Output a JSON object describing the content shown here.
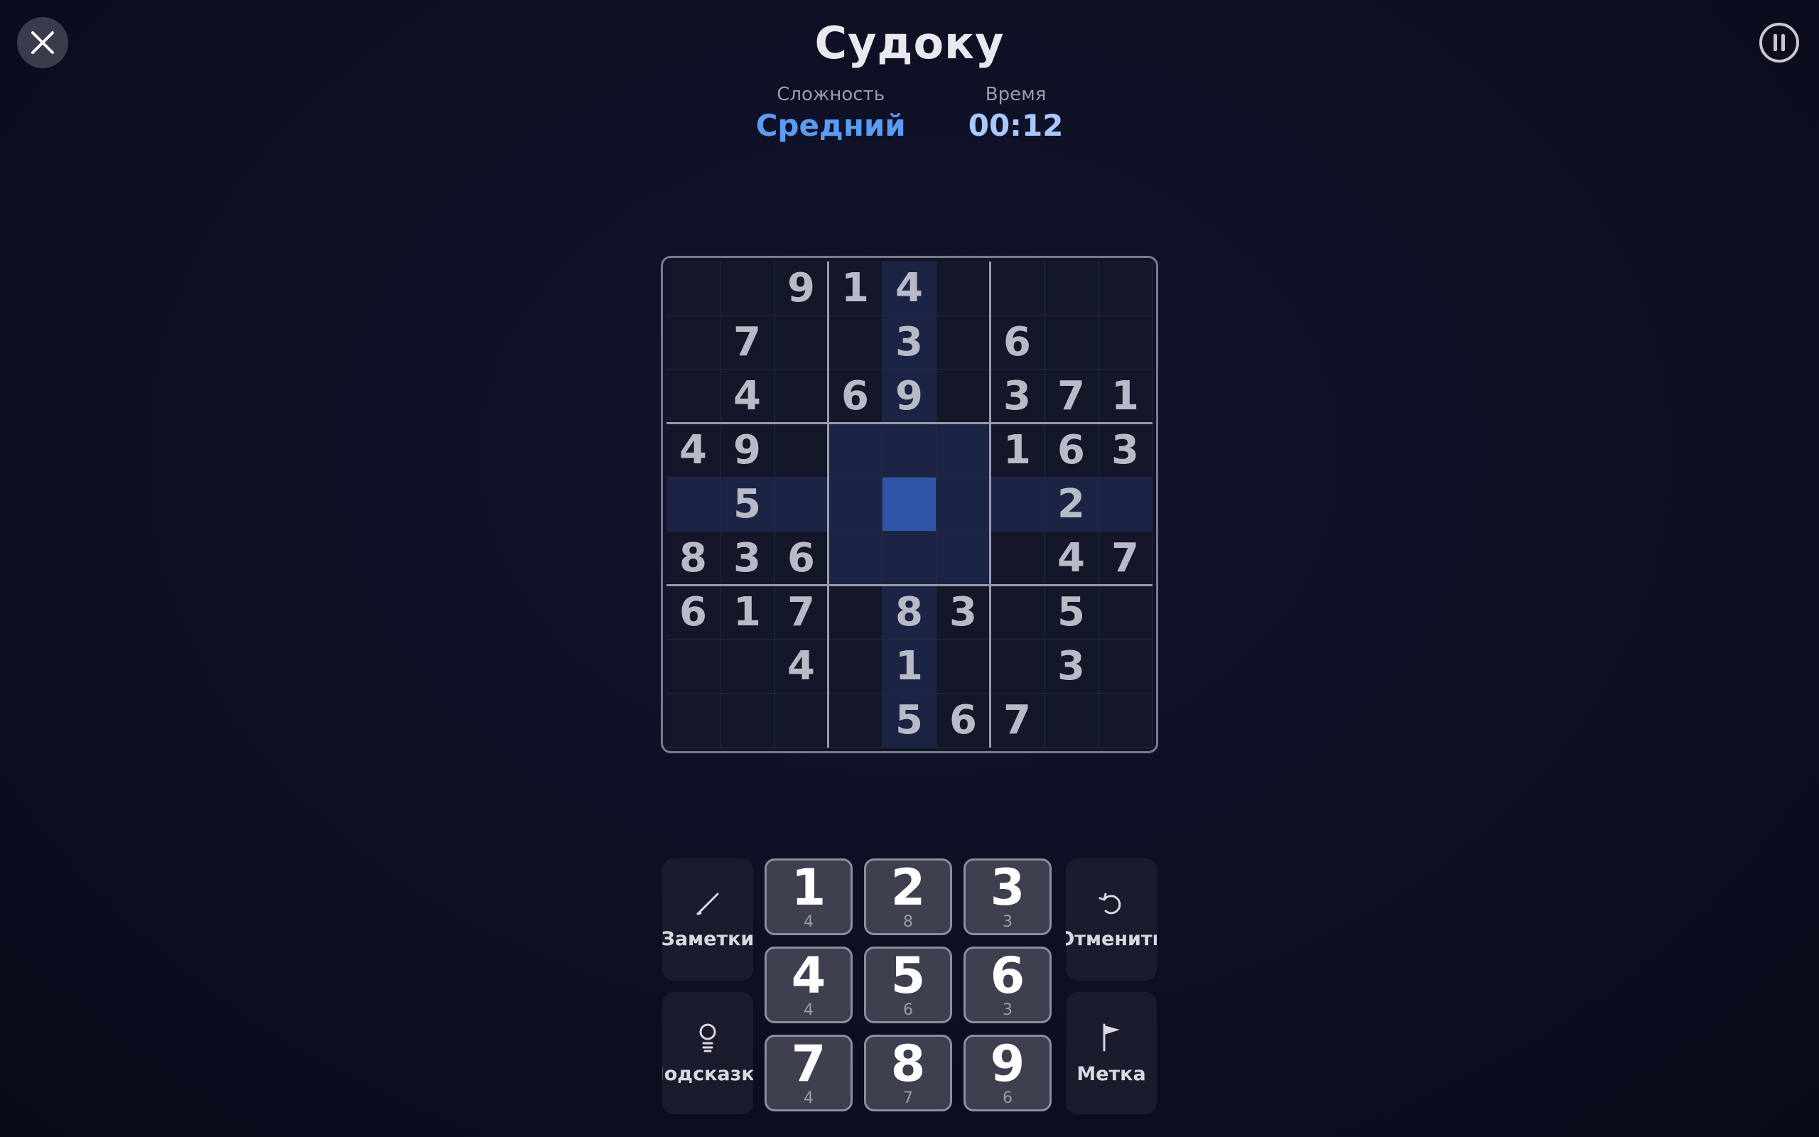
{
  "header": {
    "title": "Судоку"
  },
  "stats": {
    "difficulty_label": "Сложность",
    "difficulty_value": "Средний",
    "time_label": "Время",
    "time_value": "00:12"
  },
  "board": {
    "rows": [
      [
        "",
        "",
        "9",
        "1",
        "4",
        "",
        "",
        "",
        ""
      ],
      [
        "",
        "7",
        "",
        "",
        "3",
        "",
        "6",
        "",
        ""
      ],
      [
        "",
        "4",
        "",
        "6",
        "9",
        "",
        "3",
        "7",
        "1"
      ],
      [
        "4",
        "9",
        "",
        "",
        "",
        "",
        "1",
        "6",
        "3"
      ],
      [
        "",
        "5",
        "",
        "",
        "",
        "",
        "",
        "2",
        ""
      ],
      [
        "8",
        "3",
        "6",
        "",
        "",
        "",
        "",
        "4",
        "7"
      ],
      [
        "6",
        "1",
        "7",
        "",
        "8",
        "3",
        "",
        "5",
        ""
      ],
      [
        "",
        "",
        "4",
        "",
        "1",
        "",
        "",
        "3",
        ""
      ],
      [
        "",
        "",
        "",
        "",
        "5",
        "6",
        "7",
        "",
        ""
      ]
    ],
    "selected": {
      "row": 4,
      "col": 4
    }
  },
  "tools": {
    "notes_label": "Заметки",
    "undo_label": "Отменить",
    "hint_label": "Подсказка",
    "flag_label": "Метка"
  },
  "numpad": [
    {
      "digit": "1",
      "count": "4"
    },
    {
      "digit": "2",
      "count": "8"
    },
    {
      "digit": "3",
      "count": "3"
    },
    {
      "digit": "4",
      "count": "4"
    },
    {
      "digit": "5",
      "count": "6"
    },
    {
      "digit": "6",
      "count": "3"
    },
    {
      "digit": "7",
      "count": "4"
    },
    {
      "digit": "8",
      "count": "7"
    },
    {
      "digit": "9",
      "count": "6"
    }
  ]
}
